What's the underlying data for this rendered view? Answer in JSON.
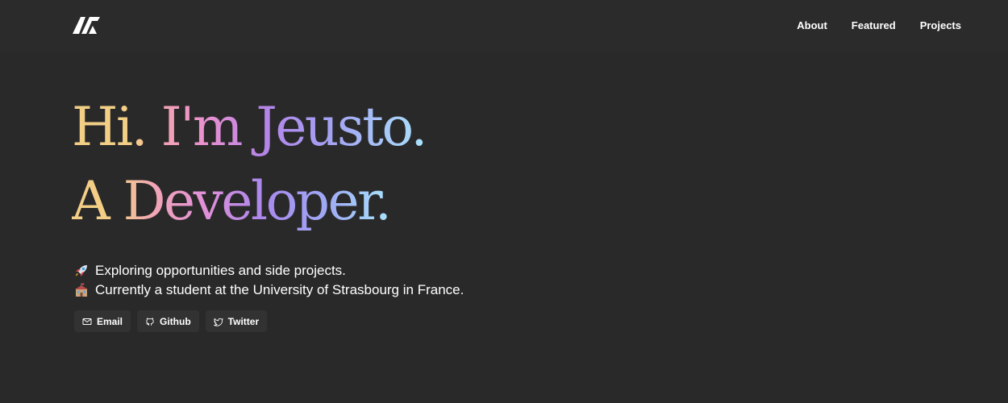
{
  "nav": {
    "logo_icon": "brand-logo-icon",
    "links": [
      "About",
      "Featured",
      "Projects"
    ]
  },
  "hero": {
    "line1": "Hi. I'm Jeusto.",
    "line2": "A Developer.",
    "gradient_colors": [
      "#f3cf86",
      "#f3a3b4",
      "#e890cf",
      "#b584e8",
      "#a3a0f2",
      "#a9e3fb"
    ]
  },
  "bio": {
    "line1": {
      "icon": "rocket-icon",
      "text": "Exploring opportunities and side projects."
    },
    "line2": {
      "icon": "school-icon",
      "text": "Currently a student at the University of Strasbourg in France."
    }
  },
  "buttons": [
    {
      "icon": "mail-icon",
      "label": "Email"
    },
    {
      "icon": "github-icon",
      "label": "Github"
    },
    {
      "icon": "twitter-icon",
      "label": "Twitter"
    }
  ],
  "colors": {
    "background": "#2a292a",
    "header": "#2c2b2c",
    "button": "#333233",
    "text": "#ffffff"
  }
}
